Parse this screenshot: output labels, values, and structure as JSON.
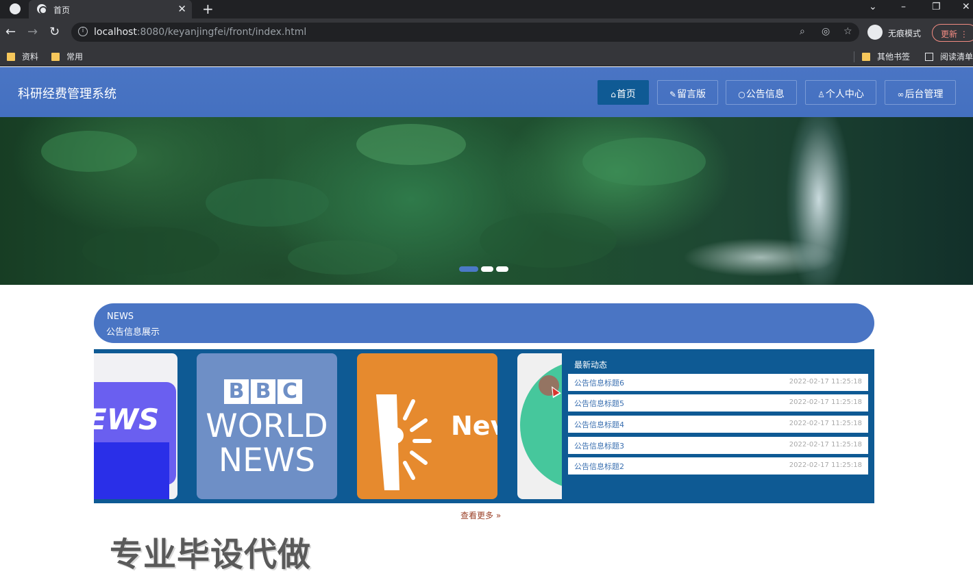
{
  "browser": {
    "tab_title": "首页",
    "url_host": "localhost",
    "url_rest": ":8080/keyanjingfei/front/index.html",
    "incognito_label": "无痕模式",
    "update_label": "更新",
    "bookmarks": [
      "资料",
      "常用"
    ],
    "bookmarks_right": [
      "其他书签",
      "阅读清单"
    ]
  },
  "site": {
    "title": "科研经费管理系统",
    "nav": [
      {
        "label": "首页",
        "icon": "home-icon",
        "active": true
      },
      {
        "label": "留言版",
        "icon": "edit-icon"
      },
      {
        "label": "公告信息",
        "icon": "chat-icon"
      },
      {
        "label": "个人中心",
        "icon": "user-icon"
      },
      {
        "label": "后台管理",
        "icon": "link-icon"
      }
    ]
  },
  "banner": {
    "slides": 3,
    "active_slide": 1
  },
  "news": {
    "heading_en": "NEWS",
    "heading_cn": "公告信息展示",
    "cards": [
      "EWS",
      "BBC WORLD NEWS",
      "Nev",
      ""
    ],
    "bbc_letters": [
      "B",
      "B",
      "C"
    ],
    "bbc_world": "WORLD",
    "bbc_news": "NEWS",
    "latest_title": "最新动态",
    "latest": [
      {
        "title": "公告信息标题6",
        "date": "2022-02-17 11:25:18"
      },
      {
        "title": "公告信息标题5",
        "date": "2022-02-17 11:25:18"
      },
      {
        "title": "公告信息标题4",
        "date": "2022-02-17 11:25:18"
      },
      {
        "title": "公告信息标题3",
        "date": "2022-02-17 11:25:18"
      },
      {
        "title": "公告信息标题2",
        "date": "2022-02-17 11:25:18"
      }
    ],
    "more_label": "查看更多 »"
  },
  "watermark": "专业毕设代做"
}
